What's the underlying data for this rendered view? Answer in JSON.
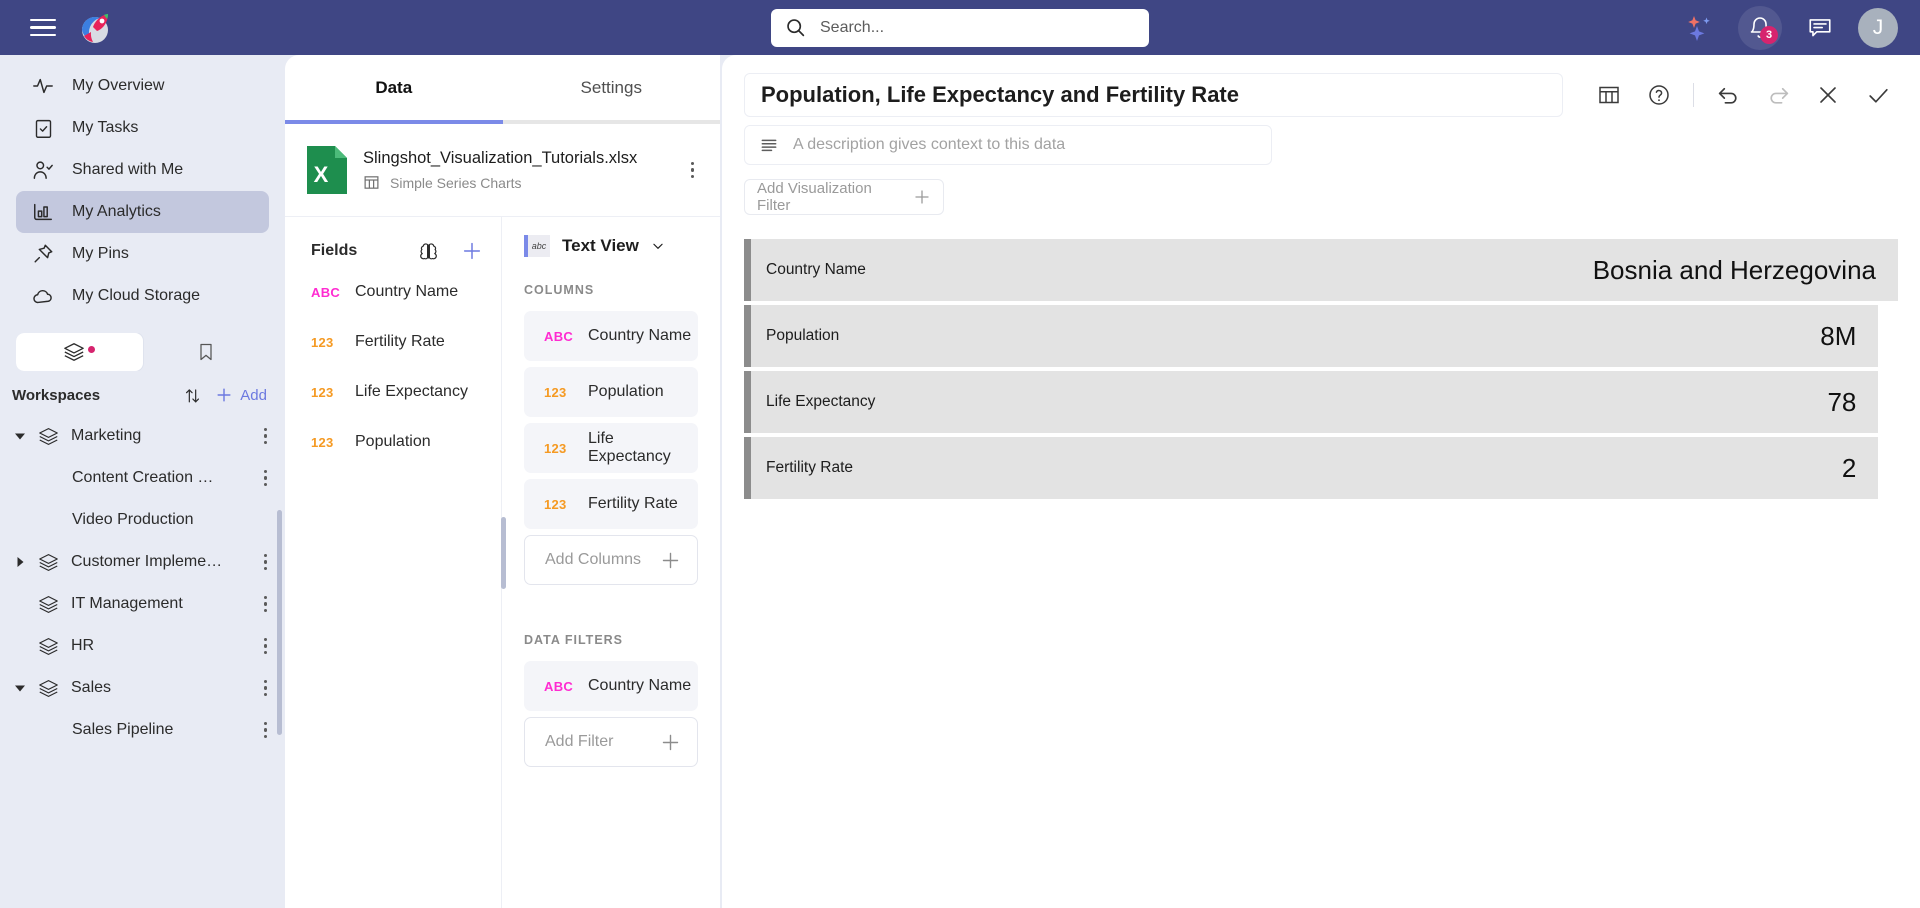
{
  "app": {
    "brand_name": "Slingshot",
    "accent_indigo": "#3f4684",
    "accent_blue": "#7b8ae8",
    "accent_pink": "#d6246e",
    "type_text_color": "#ff2bd1",
    "type_number_color": "#f59a23"
  },
  "topbar": {
    "menu_icon": "hamburger-icon",
    "logo_icon": "slingshot-logo-icon",
    "search_placeholder": "Search...",
    "search_value": "",
    "search_icon": "search-icon",
    "ai_icon": "sparkles-icon",
    "notifications_icon": "bell-icon",
    "notifications_count": "3",
    "messages_icon": "chat-icon",
    "avatar_initial": "J"
  },
  "sidebar": {
    "nav": [
      {
        "label": "My Overview",
        "icon": "activity-icon",
        "active": false
      },
      {
        "label": "My Tasks",
        "icon": "clipboard-check-icon",
        "active": false
      },
      {
        "label": "Shared with Me",
        "icon": "user-check-icon",
        "active": false
      },
      {
        "label": "My Analytics",
        "icon": "bar-chart-icon",
        "active": true
      },
      {
        "label": "My Pins",
        "icon": "pin-icon",
        "active": false
      },
      {
        "label": "My Cloud Storage",
        "icon": "cloud-icon",
        "active": false
      }
    ],
    "toggle": {
      "left_icon": "layers-icon",
      "right_icon": "bookmark-icon",
      "left_selected": true
    },
    "workspaces": {
      "title": "Workspaces",
      "sort_icon": "sort-arrows-icon",
      "add_icon": "plus-icon",
      "add_label": "Add",
      "items": [
        {
          "label": "Marketing",
          "level": 0,
          "expanded": true,
          "has_caret": true,
          "icon": "layers-icon",
          "kebab": true
        },
        {
          "label": "Content Creation an…",
          "level": 1,
          "has_caret": false,
          "kebab": true
        },
        {
          "label": "Video Production",
          "level": 1,
          "has_caret": false,
          "kebab": false
        },
        {
          "label": "Customer Implementa…",
          "level": 0,
          "expanded": false,
          "has_caret": true,
          "icon": "layers-icon",
          "kebab": true
        },
        {
          "label": "IT Management",
          "level": 0,
          "expanded": null,
          "has_caret": false,
          "icon": "layers-icon",
          "kebab": true
        },
        {
          "label": "HR",
          "level": 0,
          "expanded": null,
          "has_caret": false,
          "icon": "layers-icon",
          "kebab": true
        },
        {
          "label": "Sales",
          "level": 0,
          "expanded": true,
          "has_caret": true,
          "icon": "layers-icon",
          "kebab": true
        },
        {
          "label": "Sales Pipeline",
          "level": 1,
          "has_caret": false,
          "kebab": true
        }
      ]
    }
  },
  "panel": {
    "tabs": [
      {
        "label": "Data",
        "active": true
      },
      {
        "label": "Settings",
        "active": false
      }
    ],
    "file": {
      "name": "Slingshot_Visualization_Tutorials.xlsx",
      "sheet": "Simple Series Charts",
      "sheet_icon": "table-icon",
      "file_icon": "excel-icon",
      "file_icon_letter": "X",
      "menu_icon": "kebab-icon"
    },
    "fields": {
      "title": "Fields",
      "ai_icon": "brain-icon",
      "add_icon": "plus-icon",
      "items": [
        {
          "label": "Country Name",
          "type": "ABC"
        },
        {
          "label": "Fertility Rate",
          "type": "123"
        },
        {
          "label": "Life Expectancy",
          "type": "123"
        },
        {
          "label": "Population",
          "type": "123"
        }
      ]
    },
    "view": {
      "name": "Text View",
      "chip_text": "abc",
      "chevron_icon": "chevron-down-icon"
    },
    "columns": {
      "section_label": "COLUMNS",
      "items": [
        {
          "label": "Country Name",
          "type": "ABC"
        },
        {
          "label": "Population",
          "type": "123"
        },
        {
          "label": "Life Expectancy",
          "type": "123"
        },
        {
          "label": "Fertility Rate",
          "type": "123"
        }
      ],
      "add_label": "Add Columns",
      "add_icon": "plus-icon"
    },
    "data_filters": {
      "section_label": "DATA FILTERS",
      "items": [
        {
          "label": "Country Name",
          "type": "ABC"
        }
      ],
      "add_label": "Add Filter",
      "add_icon": "plus-icon"
    }
  },
  "viz": {
    "title": "Population, Life Expectancy and Fertility Rate",
    "description_placeholder": "A description gives context to this data",
    "description_value": "",
    "description_icon": "text-lines-icon",
    "add_viz_filter_label": "Add Visualization Filter",
    "add_viz_filter_icon": "plus-icon",
    "toolbar": [
      {
        "name": "table-icon",
        "label": "Table",
        "enabled": true
      },
      {
        "name": "help-icon",
        "label": "Help",
        "enabled": true
      },
      {
        "name": "undo-icon",
        "label": "Undo",
        "enabled": true
      },
      {
        "name": "redo-icon",
        "label": "Redo",
        "enabled": false
      },
      {
        "name": "close-icon",
        "label": "Close",
        "enabled": true
      },
      {
        "name": "check-icon",
        "label": "Apply",
        "enabled": true
      }
    ],
    "rows": [
      {
        "label": "Country Name",
        "value": "Bosnia and Herzegovina"
      },
      {
        "label": "Population",
        "value": "8M"
      },
      {
        "label": "Life Expectancy",
        "value": "78"
      },
      {
        "label": "Fertility Rate",
        "value": "2"
      }
    ]
  }
}
